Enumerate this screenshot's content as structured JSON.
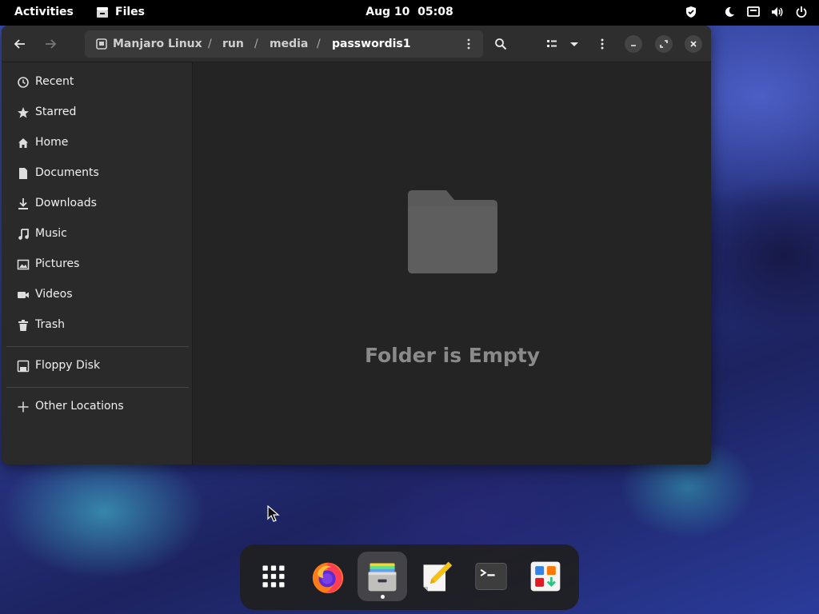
{
  "topbar": {
    "activities": "Activities",
    "app_name": "Files",
    "date": "Aug 10",
    "time": "05:08",
    "status_icons": [
      "shield-icon",
      "night-light-icon",
      "display-icon",
      "volume-icon",
      "power-icon"
    ]
  },
  "window": {
    "path": {
      "root": "Manjaro Linux",
      "segments": [
        "run",
        "media"
      ],
      "current": "passwordis1",
      "separator": "/"
    },
    "sidebar": {
      "places": [
        {
          "label": "Recent",
          "icon": "clock-icon"
        },
        {
          "label": "Starred",
          "icon": "star-icon"
        },
        {
          "label": "Home",
          "icon": "home-icon"
        },
        {
          "label": "Documents",
          "icon": "document-icon"
        },
        {
          "label": "Downloads",
          "icon": "download-icon"
        },
        {
          "label": "Music",
          "icon": "music-icon"
        },
        {
          "label": "Pictures",
          "icon": "picture-icon"
        },
        {
          "label": "Videos",
          "icon": "video-icon"
        },
        {
          "label": "Trash",
          "icon": "trash-icon"
        }
      ],
      "devices": [
        {
          "label": "Floppy Disk",
          "icon": "floppy-icon"
        }
      ],
      "other": {
        "label": "Other Locations",
        "icon": "plus-icon"
      }
    },
    "main": {
      "empty_text": "Folder is Empty"
    }
  },
  "dock": {
    "items": [
      "app-grid-icon",
      "firefox-icon",
      "files-icon",
      "text-editor-icon",
      "terminal-icon",
      "software-icon"
    ]
  },
  "colors": {
    "topbar_bg": "#000000",
    "window_bg": "#242424",
    "sidebar_bg": "#2a2a2a",
    "headerbar_bg": "#2e2e2e",
    "empty_text": "#8a8a8a",
    "folder_icon": "#5a5a5a"
  }
}
